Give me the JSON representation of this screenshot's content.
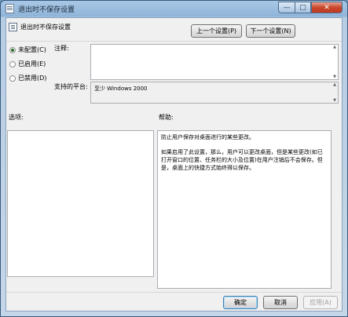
{
  "window": {
    "title": "退出时不保存设置"
  },
  "caption_buttons": {
    "minimize": "—",
    "maximize": "□",
    "close": "✕"
  },
  "setting": {
    "name": "退出时不保存设置"
  },
  "nav": {
    "prev": "上一个设置(P)",
    "next": "下一个设置(N)"
  },
  "state": {
    "options": [
      {
        "label": "未配置(C)",
        "checked": true
      },
      {
        "label": "已启用(E)",
        "checked": false
      },
      {
        "label": "已禁用(D)",
        "checked": false
      }
    ]
  },
  "comment": {
    "label": "注释:",
    "value": ""
  },
  "platform": {
    "label": "支持的平台:",
    "value": "至少 Windows 2000"
  },
  "options_section": {
    "label": "选项:"
  },
  "help_section": {
    "label": "帮助:",
    "paragraphs": [
      "防止用户保存对桌面进行的某些更改。",
      "如果启用了此设置，那么，用户可以更改桌面，但是某些更改(如已打开窗口的位置、任务栏的大小及位置)在用户注销后不会保存。但是，桌面上的快捷方式始终得以保存。"
    ]
  },
  "footer": {
    "ok": "确定",
    "cancel": "取消",
    "apply": "应用(A)"
  }
}
